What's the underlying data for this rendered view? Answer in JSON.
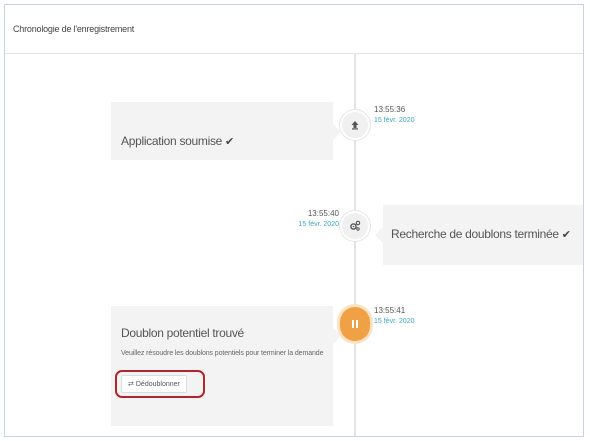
{
  "header": {
    "title": "Chronologie de l'enregistrement"
  },
  "events": [
    {
      "title": "Application soumise",
      "time": "13:55:36",
      "date": "15 févr. 2020",
      "icon": "upload-icon"
    },
    {
      "title": "Recherche de doublons terminée",
      "time": "13:55:40",
      "date": "15 févr. 2020",
      "icon": "cogs-icon"
    },
    {
      "title": "Doublon potentiel trouvé",
      "description": "Veuillez résoudre les doublons potentiels pour terminer la demande",
      "action_label": "Dédoublonner",
      "time": "13:55:41",
      "date": "15 févr. 2020",
      "icon": "pause-icon"
    }
  ],
  "colors": {
    "accent_orange": "#f0a145",
    "date_teal": "#3aa8c2",
    "highlight_red": "#b0262d"
  }
}
